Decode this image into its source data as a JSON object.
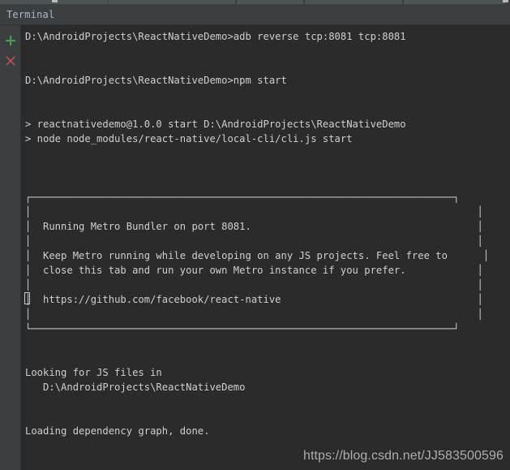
{
  "window": {
    "tool_window_tab": "Terminal"
  },
  "toolbar": {
    "buttons": [
      {
        "name": "new-session-button",
        "icon": "plus-icon",
        "color": "#499c54",
        "tooltip": "New Session"
      },
      {
        "name": "close-session-button",
        "icon": "close-x-icon",
        "color": "#c75450",
        "tooltip": "Close Session"
      }
    ]
  },
  "colors": {
    "tool_window_bg": "#3c3f41",
    "terminal_bg": "#2b2b2b",
    "terminal_fg": "#cfcfcf",
    "tab_label_fg": "#a9b7c6",
    "plus_green": "#499c54",
    "close_red": "#c75450",
    "watermark_fg": "#b9b9b9"
  },
  "terminal": {
    "lines": [
      "D:\\AndroidProjects\\ReactNativeDemo>adb reverse tcp:8081 tcp:8081",
      "",
      "",
      "D:\\AndroidProjects\\ReactNativeDemo>npm start",
      "",
      "",
      "> reactnativedemo@1.0.0 start D:\\AndroidProjects\\ReactNativeDemo",
      "> node node_modules/react-native/local-cli/cli.js start",
      "",
      "",
      "",
      "┌───────────────────────────────────────────────────────────────────────┐",
      "│                                                                           │",
      "│  Running Metro Bundler on port 8081.                                      │",
      "│                                                                           │",
      "│  Keep Metro running while developing on any JS projects. Feel free to      │",
      "│  close this tab and run your own Metro instance if you prefer.            │",
      "│                                                                           │",
      "│  https://github.com/facebook/react-native                                 │",
      "│                                                                           │",
      "└───────────────────────────────────────────────────────────────────────┘",
      "",
      "",
      "Looking for JS files in",
      "   D:\\AndroidProjects\\ReactNativeDemo",
      "",
      "",
      "Loading dependency graph, done."
    ],
    "caret_line_index": 18,
    "caret_column": 0
  },
  "watermark": {
    "text": "https://blog.csdn.net/JJ583500596"
  }
}
